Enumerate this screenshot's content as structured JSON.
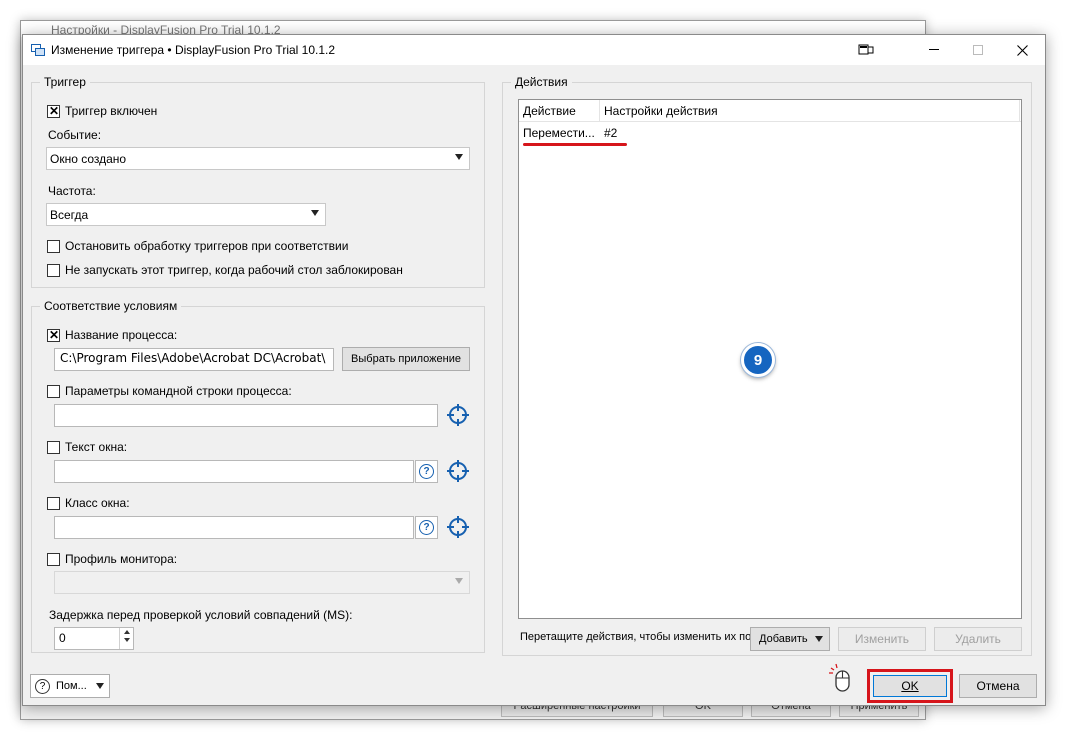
{
  "background_window": {
    "title": "Настройки - DisplayFusion Pro Trial 10.1.2",
    "buttons": [
      "Расширенные настройки",
      "OK",
      "Отмена",
      "Применить"
    ]
  },
  "dialog": {
    "title": "Изменение триггера • DisplayFusion Pro Trial 10.1.2"
  },
  "trigger": {
    "group_label": "Триггер",
    "enabled_label": "Триггер включен",
    "enabled_checked": true,
    "event_label": "Событие:",
    "event_value": "Окно создано",
    "frequency_label": "Частота:",
    "frequency_value": "Всегда",
    "stop_label": "Остановить обработку триггеров при соответствии",
    "stop_checked": false,
    "locked_label": "Не запускать этот триггер, когда рабочий стол заблокирован",
    "locked_checked": false
  },
  "conditions": {
    "group_label": "Соответствие условиям",
    "process_name_label": "Название процесса:",
    "process_name_checked": true,
    "process_name_value": "C:\\Program Files\\Adobe\\Acrobat DC\\Acrobat\\",
    "select_app_button": "Выбрать приложение",
    "cmdline_label": "Параметры командной строки процесса:",
    "cmdline_checked": false,
    "cmdline_value": "",
    "window_text_label": "Текст окна:",
    "window_text_checked": false,
    "window_text_value": "",
    "window_class_label": "Класс окна:",
    "window_class_checked": false,
    "window_class_value": "",
    "monitor_profile_label": "Профиль монитора:",
    "monitor_profile_checked": false,
    "monitor_profile_value": "",
    "delay_label": "Задержка перед проверкой условий совпадений (MS):",
    "delay_value": "0"
  },
  "actions": {
    "group_label": "Действия",
    "columns": [
      "Действие",
      "Настройки действия"
    ],
    "rows": [
      {
        "action": "Перемести...",
        "settings": "#2"
      }
    ],
    "hint": "Перетащите действия, чтобы изменить их по...",
    "add_button": "Добавить",
    "edit_button": "Изменить",
    "delete_button": "Удалить",
    "step_badge": "9"
  },
  "footer": {
    "help_button": "Пом...",
    "ok_button": "OK",
    "cancel_button": "Отмена"
  },
  "colors": {
    "accent_blue": "#1660b0",
    "highlight_red": "#d6151b",
    "badge_blue": "#1565c0"
  }
}
